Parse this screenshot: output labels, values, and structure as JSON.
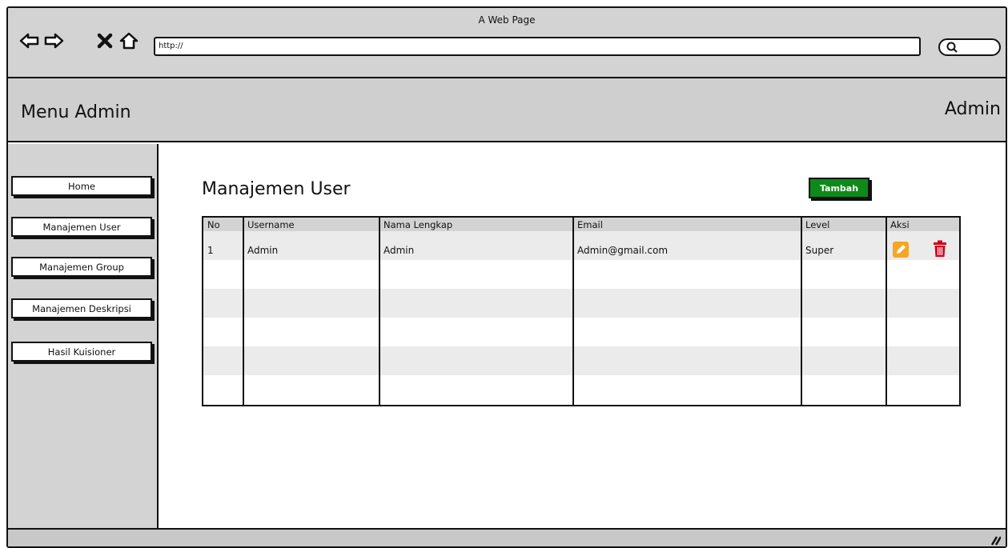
{
  "browser": {
    "window_title": "A Web Page",
    "url": "http://"
  },
  "header": {
    "app_title": "Menu Admin",
    "user_label": "Admin"
  },
  "sidebar": {
    "items": [
      {
        "label": "Home"
      },
      {
        "label": "Manajemen User"
      },
      {
        "label": "Manajemen Group"
      },
      {
        "label": "Manajemen Deskripsi"
      },
      {
        "label": "Hasil Kuisioner"
      }
    ]
  },
  "main": {
    "page_title": "Manajemen User",
    "add_button_label": "Tambah",
    "add_button_color": "#0e8a1a",
    "table": {
      "columns": [
        "No",
        "Username",
        "Nama Lengkap",
        "Email",
        "Level",
        "Aksi"
      ],
      "rows": [
        {
          "no": "1",
          "username": "Admin",
          "full_name": "Admin",
          "email": "Admin@gmail.com",
          "level": "Super"
        }
      ]
    },
    "edit_icon_color": "#f5a623",
    "delete_icon_color": "#d0021b"
  }
}
